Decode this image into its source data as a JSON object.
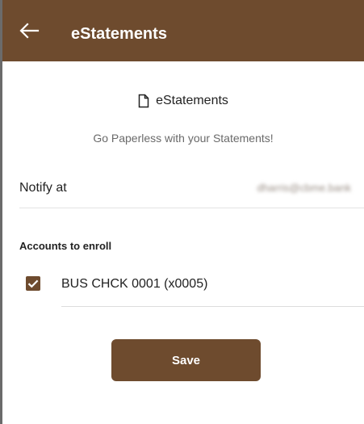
{
  "app_bar": {
    "title": "eStatements",
    "back_icon": "arrow-left-icon",
    "background": "#6e4b2e"
  },
  "header": {
    "icon": "document-icon",
    "title": "eStatements",
    "tagline": "Go Paperless with your Statements!"
  },
  "notify": {
    "label": "Notify at",
    "value": "dharris@cbme.bank"
  },
  "accounts": {
    "section_label": "Accounts to enroll",
    "items": [
      {
        "label": "BUS CHCK 0001 (x0005)",
        "checked": true
      }
    ]
  },
  "actions": {
    "save_label": "Save"
  },
  "colors": {
    "brand": "#6e4b2e",
    "muted_text": "#6a6a6a"
  }
}
